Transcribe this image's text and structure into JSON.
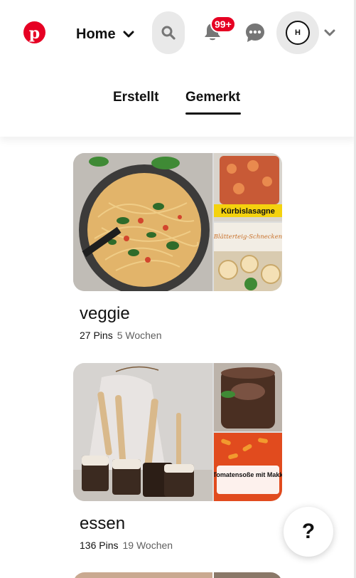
{
  "nav": {
    "home_label": "Home",
    "notifications_badge": "99+",
    "avatar_initial": "H"
  },
  "tabs": [
    {
      "label": "Erstellt",
      "active": false
    },
    {
      "label": "Gemerkt",
      "active": true
    }
  ],
  "boards": [
    {
      "title": "veggie",
      "pins": "27 Pins",
      "age": "5 Wochen",
      "thumb_text": [
        "Kürbislasagne",
        "Blätterteig-Schnecken"
      ]
    },
    {
      "title": "essen",
      "pins": "136 Pins",
      "age": "19 Wochen",
      "thumb_text": [
        "DDR Tomatensoße mit Makkaroni"
      ]
    }
  ],
  "help": {
    "label": "?"
  },
  "colors": {
    "brand": "#e60023",
    "pill": "#e9e9e9"
  }
}
